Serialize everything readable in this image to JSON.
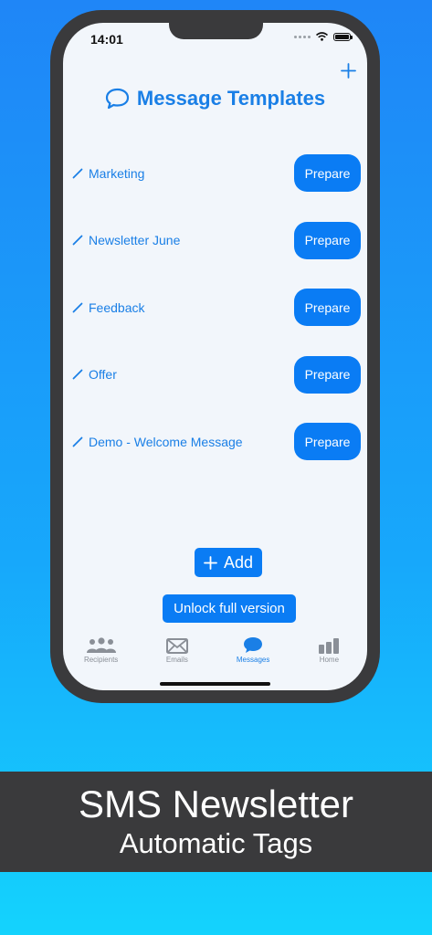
{
  "status_bar": {
    "time": "14:01"
  },
  "header": {
    "title": "Message Templates",
    "add_icon": "plus-icon",
    "title_icon": "speech-bubble-icon"
  },
  "templates": [
    {
      "name": "Marketing",
      "action": "Prepare"
    },
    {
      "name": "Newsletter June",
      "action": "Prepare"
    },
    {
      "name": "Feedback",
      "action": "Prepare"
    },
    {
      "name": "Offer",
      "action": "Prepare"
    },
    {
      "name": "Demo - Welcome Message",
      "action": "Prepare"
    }
  ],
  "actions": {
    "add_label": "Add",
    "unlock_label": "Unlock full version"
  },
  "tabs": [
    {
      "label": "Recipients",
      "icon": "people-icon",
      "active": false
    },
    {
      "label": "Emails",
      "icon": "envelope-icon",
      "active": false
    },
    {
      "label": "Messages",
      "icon": "speech-bubble-icon",
      "active": true
    },
    {
      "label": "Home",
      "icon": "bar-chart-icon",
      "active": false
    }
  ],
  "banner": {
    "title": "SMS Newsletter",
    "subtitle": "Automatic Tags"
  },
  "colors": {
    "accent": "#0a7cf4",
    "text_accent": "#1a7fe6",
    "frame": "#3a3a3c",
    "screen_bg": "#f2f6fb",
    "inactive": "#8a8f97"
  }
}
